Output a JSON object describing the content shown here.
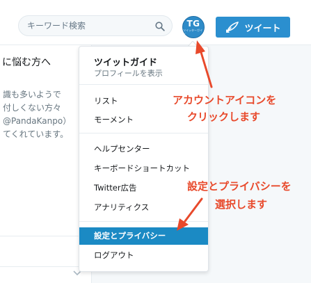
{
  "header": {
    "search": {
      "placeholder": "キーワード検索"
    },
    "avatar": {
      "initials": "TG",
      "caption": "ツイッターガイド"
    },
    "tweet_button": {
      "label": "ツイート"
    }
  },
  "timeline": {
    "heading": "に悩む方へ",
    "lines": [
      "識も多いようで",
      "付しくない方々",
      "@PandaKanpo）",
      "てくれています。"
    ]
  },
  "menu": {
    "profile_name": "ツイットガイド",
    "profile_sub": "プロフィールを表示",
    "items_a": [
      "リスト",
      "モーメント"
    ],
    "items_b": [
      "ヘルプセンター",
      "キーボードショートカット",
      "Twitter広告",
      "アナリティクス"
    ],
    "items_c": [
      "設定とプライバシー",
      "ログアウト"
    ],
    "active_item": "設定とプライバシー"
  },
  "annotations": {
    "note1": [
      "アカウントアイコンを",
      "クリックします"
    ],
    "note2": [
      "設定とプライバシーを",
      "選択します"
    ]
  },
  "colors": {
    "accent": "#1b8ac4",
    "tweet_button": "#2b8fcf",
    "annotation": "#e8492b"
  }
}
